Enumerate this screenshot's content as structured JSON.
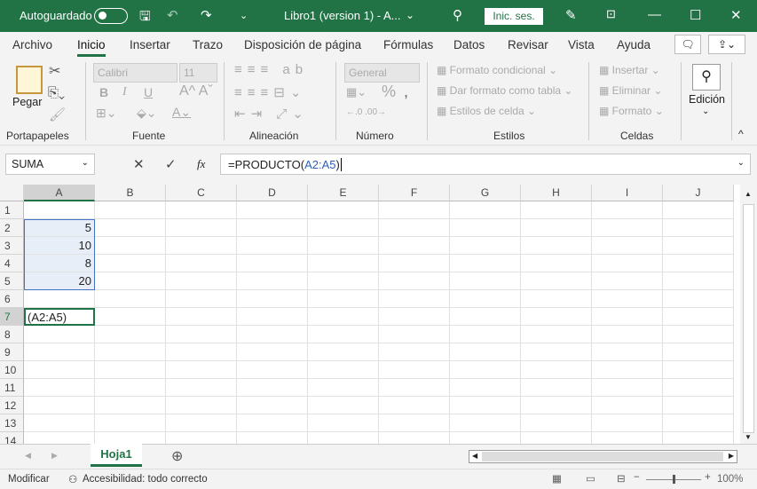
{
  "titlebar": {
    "autosave": "Autoguardado",
    "doc_title": "Libro1 (version 1)  -  A...",
    "signin": "Inic. ses."
  },
  "tabs": [
    "Archivo",
    "Inicio",
    "Insertar",
    "Trazo",
    "Disposición de página",
    "Fórmulas",
    "Datos",
    "Revisar",
    "Vista",
    "Ayuda"
  ],
  "ribbon": {
    "clipboard": {
      "paste": "Pegar",
      "label": "Portapapeles"
    },
    "font": {
      "name": "Calibri",
      "size": "11",
      "label": "Fuente",
      "bold": "B",
      "italic": "I",
      "underline": "U"
    },
    "alignment": {
      "label": "Alineación"
    },
    "number": {
      "format": "General",
      "percent": "%",
      "label": "Número"
    },
    "styles": {
      "items": [
        "Formato condicional",
        "Dar formato como tabla",
        "Estilos de celda"
      ],
      "label": "Estilos"
    },
    "cells": {
      "items": [
        "Insertar",
        "Eliminar",
        "Formato"
      ],
      "label": "Celdas"
    },
    "editing": {
      "label": "Edición"
    }
  },
  "formula_bar": {
    "name_box": "SUMA",
    "fx": "fx",
    "formula_prefix": "=PRODUCTO(",
    "formula_ref": "A2:A5",
    "formula_suffix": ")"
  },
  "grid": {
    "columns": [
      "A",
      "B",
      "C",
      "D",
      "E",
      "F",
      "G",
      "H",
      "I",
      "J"
    ],
    "rows": [
      "1",
      "2",
      "3",
      "4",
      "5",
      "6",
      "7",
      "8",
      "9",
      "10",
      "11",
      "12",
      "13",
      "14"
    ],
    "values": {
      "A2": "5",
      "A3": "10",
      "A4": "8",
      "A5": "20"
    },
    "edit_cell_text": "(A2:A5)"
  },
  "sheets": [
    "Hoja1"
  ],
  "status": {
    "mode": "Modificar",
    "accessibility": "Accesibilidad: todo correcto",
    "zoom": "100%"
  }
}
